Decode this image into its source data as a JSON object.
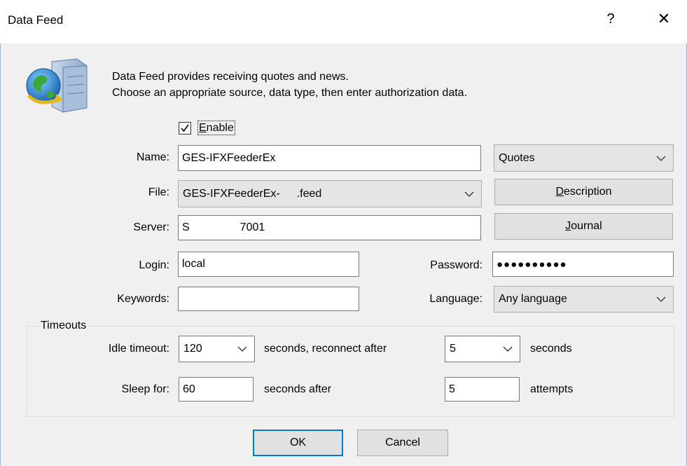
{
  "window": {
    "title": "Data Feed",
    "help_label": "?",
    "close_label": "✕"
  },
  "description": {
    "line1": "Data Feed provides receiving quotes and news.",
    "line2": "Choose an appropriate source, data type, then enter authorization data."
  },
  "enable": {
    "label_rest": "nable",
    "label_mnemonic": "E",
    "checked": true
  },
  "name": {
    "label": "Name:",
    "value": "GES-IFXFeederEx"
  },
  "type": {
    "value": "Quotes"
  },
  "file": {
    "label": "File:",
    "value": "GES-IFXFeederEx-  .feed"
  },
  "description_button": {
    "mnemonic": "D",
    "rest": "escription"
  },
  "server": {
    "label": "Server:",
    "value": "S     7001"
  },
  "journal_button": {
    "mnemonic": "J",
    "rest": "ournal"
  },
  "login": {
    "label": "Login:",
    "value": "local"
  },
  "password": {
    "label": "Password:",
    "value": "●●●●●●●●●●"
  },
  "keywords": {
    "label": "Keywords:",
    "value": ""
  },
  "language": {
    "label": "Language:",
    "value": "Any language"
  },
  "timeouts": {
    "title": "Timeouts",
    "idle_label": "Idle timeout:",
    "idle_value": "120",
    "reconnect_text": "seconds, reconnect after",
    "reconnect_value": "5",
    "seconds_text": "seconds",
    "sleep_label": "Sleep for:",
    "sleep_value": "60",
    "seconds_after_text": "seconds after",
    "attempts_value": "5",
    "attempts_text": "attempts"
  },
  "buttons": {
    "ok": "OK",
    "cancel": "Cancel"
  }
}
